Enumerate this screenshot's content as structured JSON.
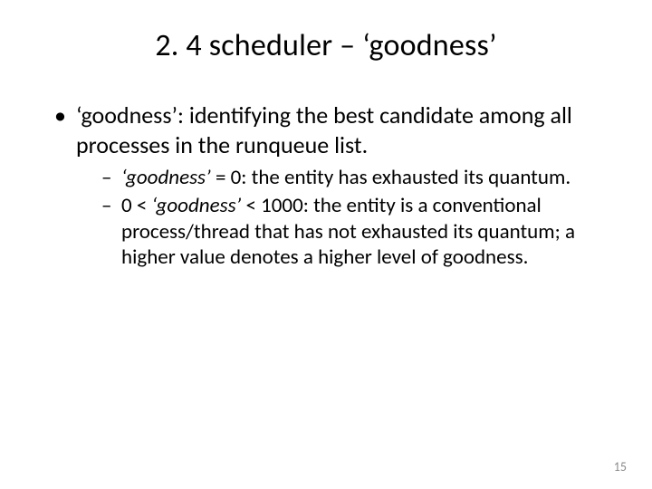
{
  "slide": {
    "title": "2. 4 scheduler – ‘goodness’",
    "bullet1_prefix": "‘goodness’: ",
    "bullet1_rest": "identifying the best candidate among all processes in the runqueue list.",
    "sub1_em": "‘goodness’",
    "sub1_rest": " = 0: the entity has exhausted its quantum.",
    "sub2_pre": "0 < ",
    "sub2_em": "‘goodness’",
    "sub2_rest": " < 1000: the entity is a conventional process/thread that has not exhausted its quantum; a higher value denotes a higher level of goodness.",
    "page_number": "15"
  }
}
